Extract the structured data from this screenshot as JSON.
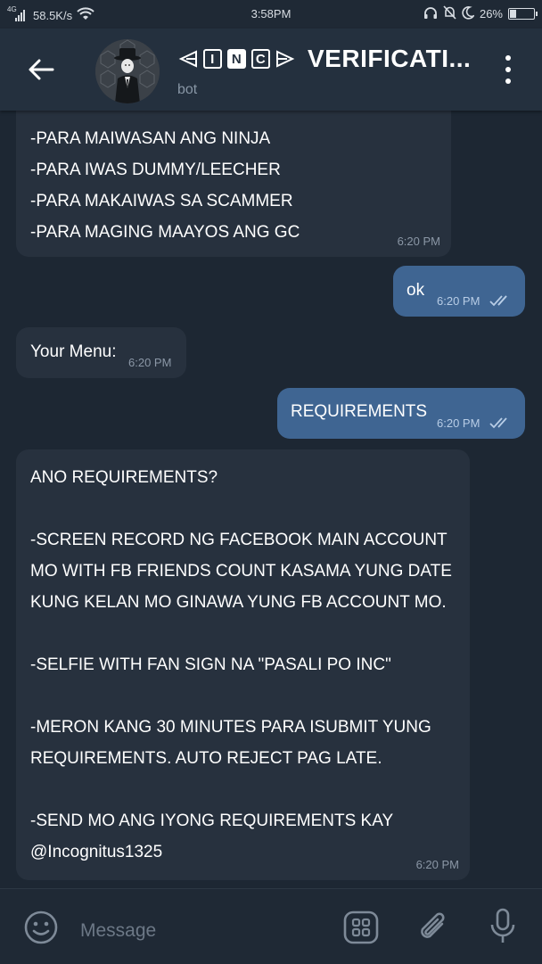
{
  "status_bar": {
    "network": "4G",
    "speed": "58.5K/s",
    "time": "3:58PM",
    "battery": "26%",
    "battery_level": 0.26
  },
  "header": {
    "title_boxes": [
      "I",
      "N",
      "C"
    ],
    "title_text": "VERIFICATI...",
    "subtitle": "bot"
  },
  "messages": [
    {
      "direction": "incoming",
      "lines": [
        "-PARA MAIWASAN ANG NINJA",
        "-PARA IWAS DUMMY/LEECHER",
        "-PARA MAKAIWAS SA SCAMMER",
        "-PARA MAGING MAAYOS ANG GC"
      ],
      "time": "6:20 PM"
    },
    {
      "direction": "outgoing",
      "text": "ok",
      "time": "6:20 PM",
      "read": true
    },
    {
      "direction": "incoming",
      "text": "Your Menu:",
      "time": "6:20 PM"
    },
    {
      "direction": "outgoing",
      "text": "REQUIREMENTS",
      "time": "6:20 PM",
      "read": true
    },
    {
      "direction": "incoming",
      "lines": [
        "ANO REQUIREMENTS?",
        "",
        "-SCREEN RECORD NG FACEBOOK MAIN ACCOUNT",
        "MO WITH FB FRIENDS COUNT KASAMA YUNG DATE",
        "KUNG KELAN MO GINAWA YUNG FB ACCOUNT MO.",
        "",
        "-SELFIE WITH FAN SIGN NA \"PASALI PO INC\"",
        "",
        "-MERON KANG 30 MINUTES PARA ISUBMIT YUNG",
        "REQUIREMENTS. AUTO REJECT PAG LATE.",
        "",
        "-SEND MO ANG IYONG REQUIREMENTS KAY",
        "@Incognitus1325"
      ],
      "time": "6:20 PM"
    }
  ],
  "composer": {
    "placeholder": "Message",
    "icons": [
      "emoji-icon",
      "bot-commands-icon",
      "attach-icon",
      "mic-icon"
    ]
  },
  "colors": {
    "background": "#1d2733",
    "header": "#24303e",
    "incoming_bubble": "#27313e",
    "outgoing_bubble": "#3f6592"
  }
}
